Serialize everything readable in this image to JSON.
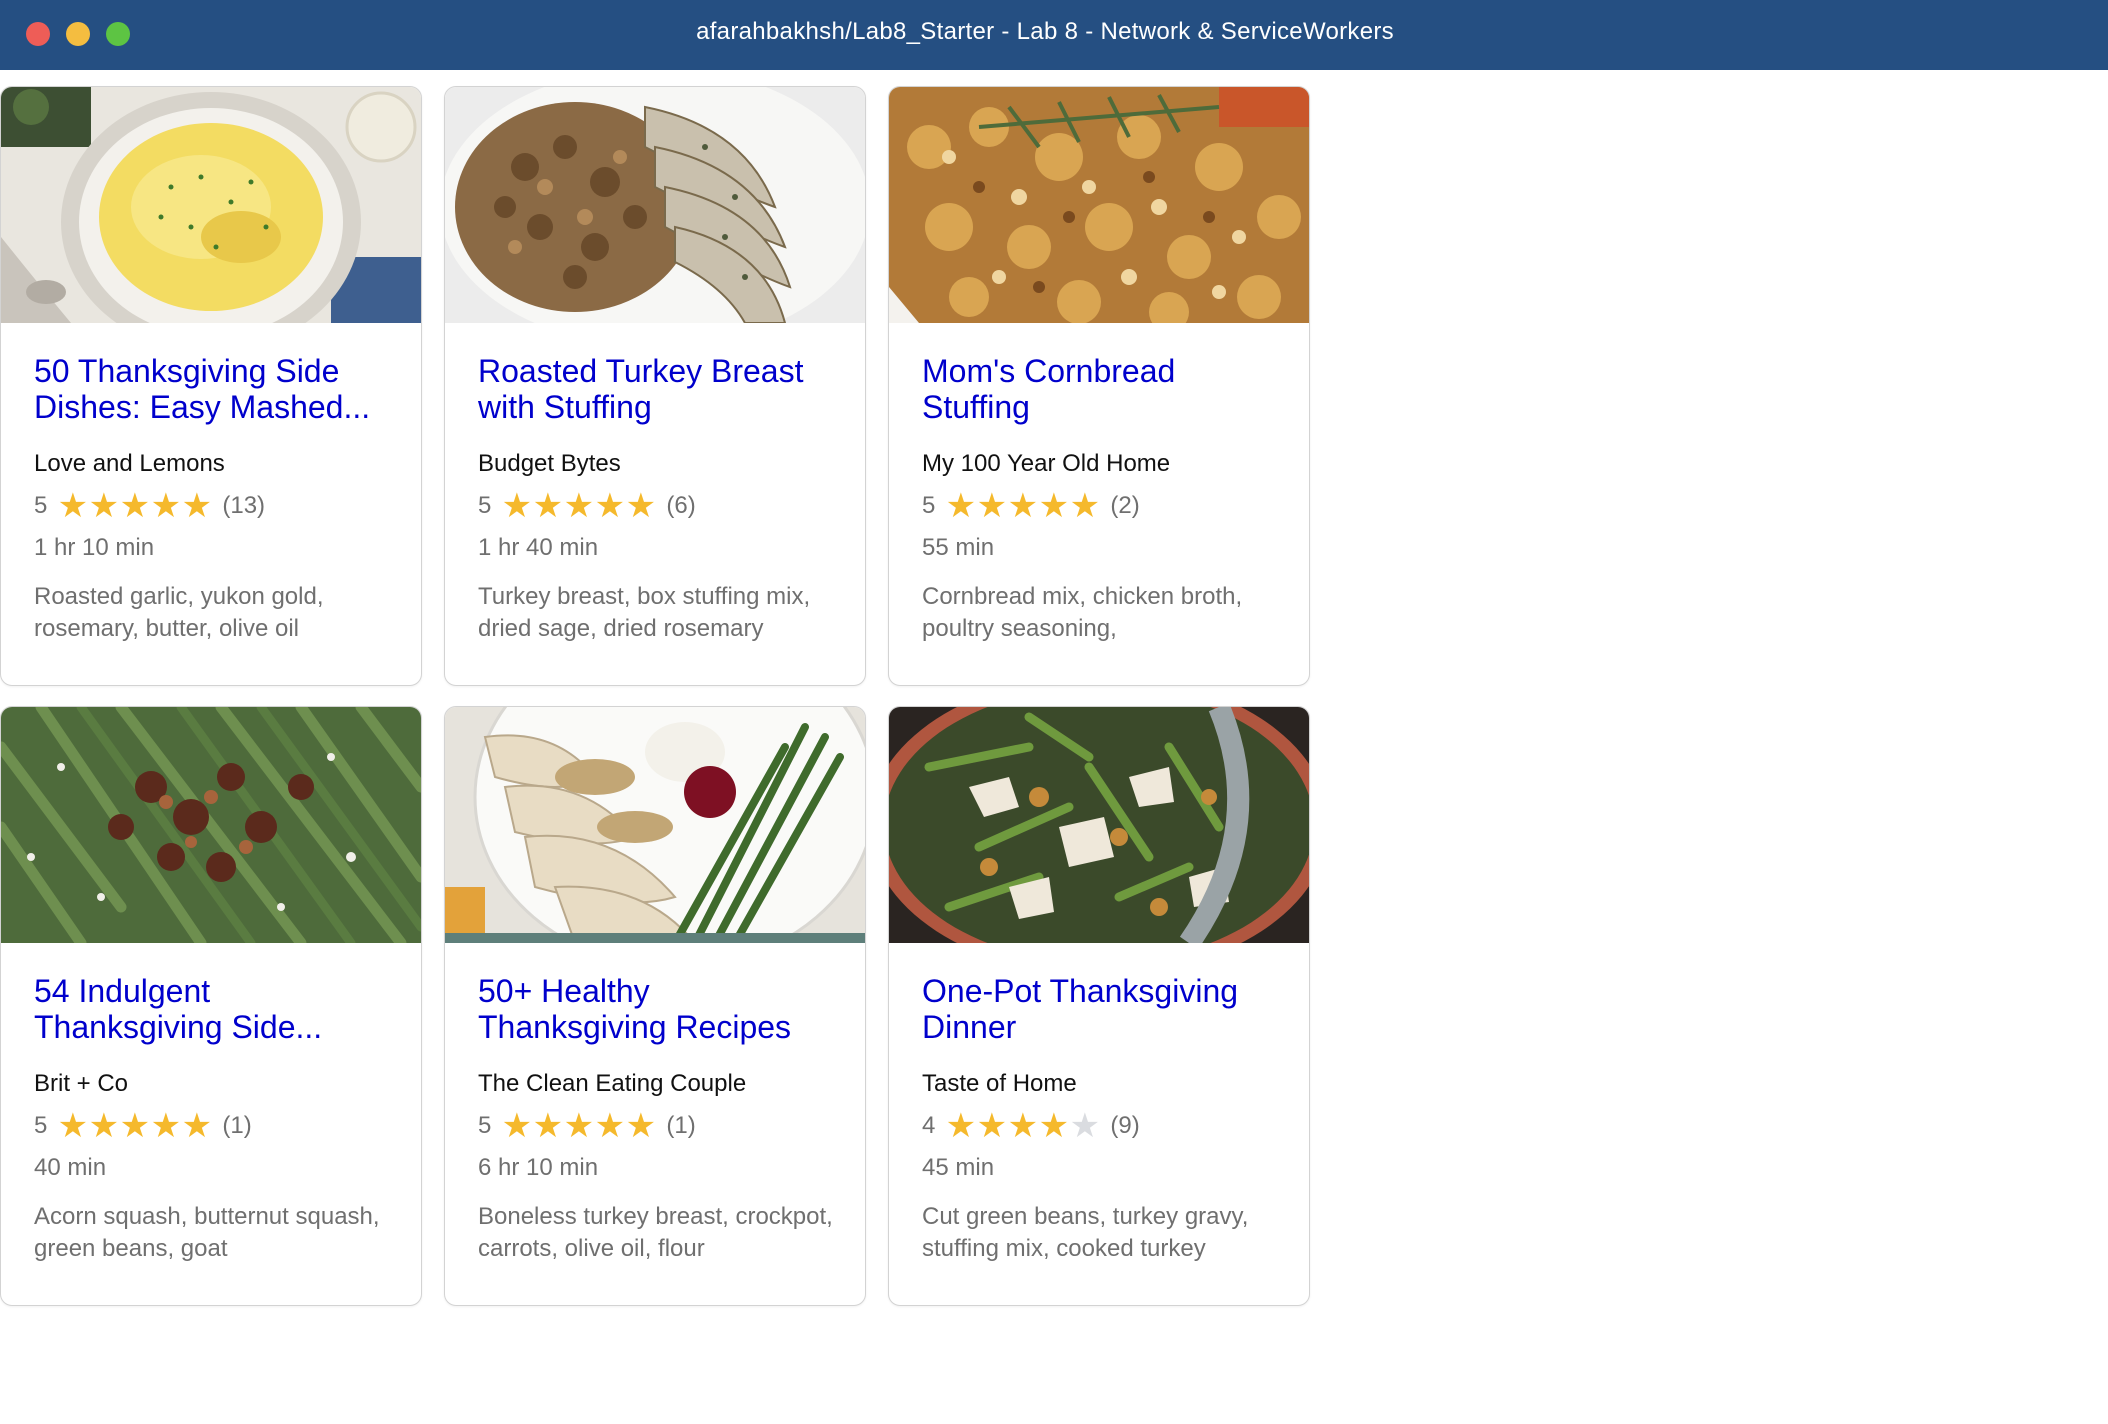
{
  "window": {
    "title": "afarahbakhsh/Lab8_Starter - Lab 8 - Network & ServiceWorkers"
  },
  "recipes": [
    {
      "title": "50 Thanksgiving Side Dishes: Easy Mashed...",
      "org": "Love and Lemons",
      "rating_text": "5",
      "rating_value": 5,
      "review_count": "(13)",
      "time": "1 hr 10 min",
      "ingredients": "Roasted garlic, yukon gold, rosemary, butter, olive oil",
      "image": "mashed-potatoes"
    },
    {
      "title": "Roasted Turkey Breast with Stuffing",
      "org": "Budget Bytes",
      "rating_text": "5",
      "rating_value": 5,
      "review_count": "(6)",
      "time": "1 hr 40 min",
      "ingredients": "Turkey breast, box stuffing mix, dried sage, dried rosemary",
      "image": "turkey-stuffing"
    },
    {
      "title": "Mom's Cornbread Stuffing",
      "org": "My 100 Year Old Home",
      "rating_text": "5",
      "rating_value": 5,
      "review_count": "(2)",
      "time": "55 min",
      "ingredients": "Cornbread mix, chicken broth, poultry seasoning,",
      "image": "cornbread-stuffing"
    },
    {
      "title": "54 Indulgent Thanksgiving Side...",
      "org": "Brit + Co",
      "rating_text": "5",
      "rating_value": 5,
      "review_count": "(1)",
      "time": "40 min",
      "ingredients": "Acorn squash, butternut squash, green beans, goat",
      "image": "green-beans"
    },
    {
      "title": "50+ Healthy Thanksgiving Recipes",
      "org": "The Clean Eating Couple",
      "rating_text": "5",
      "rating_value": 5,
      "review_count": "(1)",
      "time": "6 hr 10 min",
      "ingredients": "Boneless turkey breast, crockpot, carrots, olive oil, flour",
      "image": "turkey-plate"
    },
    {
      "title": "One-Pot Thanksgiving Dinner",
      "org": "Taste of Home",
      "rating_text": "4",
      "rating_value": 4,
      "review_count": "(9)",
      "time": "45 min",
      "ingredients": "Cut green beans, turkey gravy, stuffing mix, cooked turkey",
      "image": "one-pot-dinner"
    }
  ],
  "colors": {
    "titlebar": "#254f82",
    "link_title": "#0000cc",
    "star_filled": "#f5b92c",
    "star_empty": "#dadce0"
  }
}
